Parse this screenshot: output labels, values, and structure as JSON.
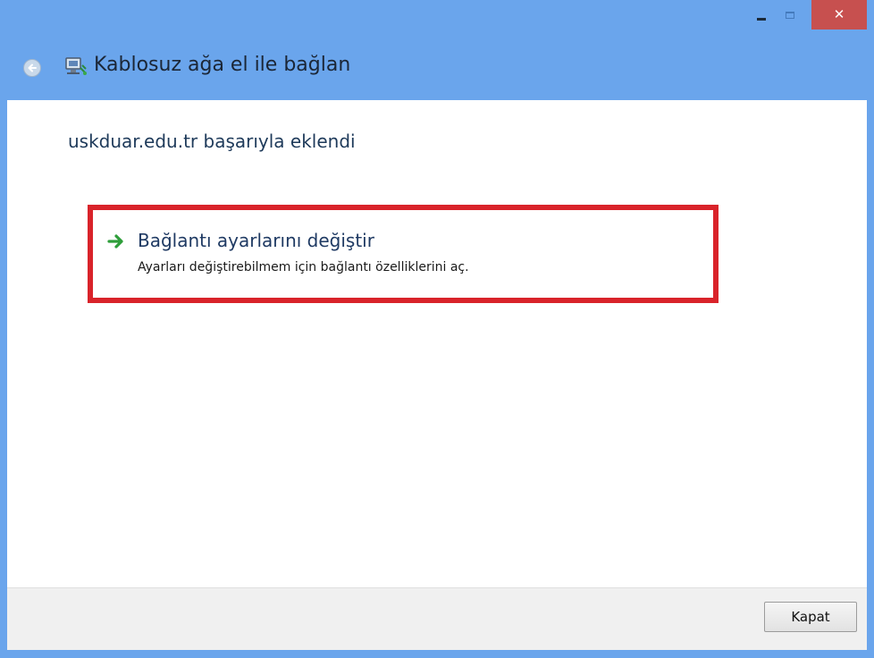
{
  "window": {
    "title_buttons": {
      "close_glyph": "✕"
    },
    "nav": {
      "title": "Kablosuz ağa el ile bağlan"
    },
    "content": {
      "success_message": "uskduar.edu.tr başarıyla eklendi",
      "command_link": {
        "title": "Bağlantı ayarlarını değiştir",
        "description": "Ayarları değiştirebilmem için bağlantı özelliklerini aç."
      }
    },
    "footer": {
      "close_button_label": "Kapat"
    }
  },
  "colors": {
    "frame": "#6aa5ec",
    "close_button": "#c7504f",
    "highlight": "#d9232a",
    "link_text": "#1f3a63",
    "arrow": "#2e9e3a"
  },
  "icons": [
    "back-arrow-icon",
    "network-wizard-icon",
    "green-arrow-icon",
    "minimize-icon",
    "maximize-icon",
    "close-icon"
  ]
}
